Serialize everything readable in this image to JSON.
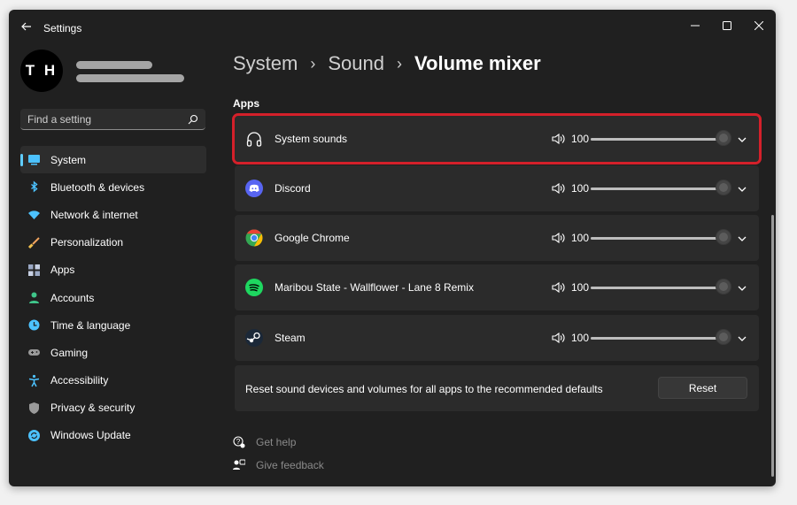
{
  "window": {
    "title": "Settings"
  },
  "profile": {
    "initials": "T H"
  },
  "search": {
    "placeholder": "Find a setting"
  },
  "sidebar": {
    "items": [
      {
        "label": "System",
        "icon": "monitor-icon",
        "active": true
      },
      {
        "label": "Bluetooth & devices",
        "icon": "bluetooth-icon"
      },
      {
        "label": "Network & internet",
        "icon": "wifi-icon"
      },
      {
        "label": "Personalization",
        "icon": "brush-icon"
      },
      {
        "label": "Apps",
        "icon": "apps-icon"
      },
      {
        "label": "Accounts",
        "icon": "person-icon"
      },
      {
        "label": "Time & language",
        "icon": "globe-clock-icon"
      },
      {
        "label": "Gaming",
        "icon": "gamepad-icon"
      },
      {
        "label": "Accessibility",
        "icon": "accessibility-icon"
      },
      {
        "label": "Privacy & security",
        "icon": "shield-icon"
      },
      {
        "label": "Windows Update",
        "icon": "update-icon"
      }
    ]
  },
  "breadcrumb": {
    "level1": "System",
    "level2": "Sound",
    "current": "Volume mixer",
    "separator": "›"
  },
  "apps_section": {
    "title": "Apps",
    "rows": [
      {
        "name": "System sounds",
        "icon": "headphones-icon",
        "volume": "100",
        "level": 1.0,
        "highlighted": true
      },
      {
        "name": "Discord",
        "icon": "discord-icon",
        "volume": "100",
        "level": 1.0
      },
      {
        "name": "Google Chrome",
        "icon": "chrome-icon",
        "volume": "100",
        "level": 1.0
      },
      {
        "name": "Maribou State - Wallflower - Lane 8 Remix",
        "icon": "spotify-icon",
        "volume": "100",
        "level": 1.0
      },
      {
        "name": "Steam",
        "icon": "steam-icon",
        "volume": "100",
        "level": 1.0
      }
    ]
  },
  "reset": {
    "text": "Reset sound devices and volumes for all apps to the recommended defaults",
    "button": "Reset"
  },
  "footer": {
    "help": "Get help",
    "feedback": "Give feedback"
  },
  "colors": {
    "accent": "#60cdff",
    "highlight_border": "#d4202a",
    "background": "#202020",
    "card": "#2b2b2b"
  }
}
